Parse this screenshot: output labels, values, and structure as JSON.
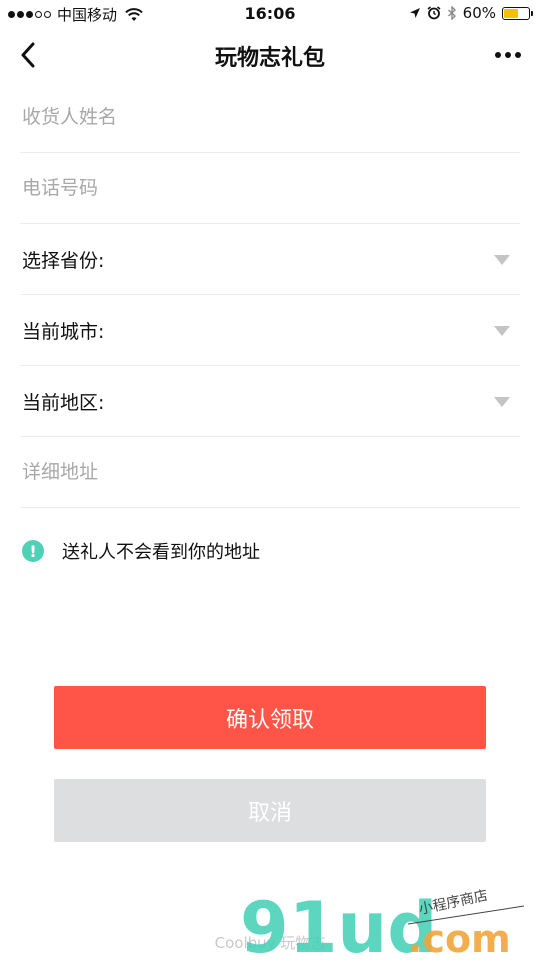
{
  "status_bar": {
    "carrier": "中国移动",
    "time": "16:06",
    "battery": "60%",
    "battery_level": 0.6,
    "icons": [
      "signal-dots-icon",
      "wifi-icon",
      "location-arrow-icon",
      "alarm-icon",
      "bluetooth-icon",
      "battery-icon"
    ]
  },
  "nav": {
    "title": "玩物志礼包",
    "back_icon": "chevron-left-icon",
    "more_icon": "more-dots-icon"
  },
  "form": {
    "name_placeholder": "收货人姓名",
    "phone_placeholder": "电话号码",
    "province_label": "选择省份:",
    "city_label": "当前城市:",
    "district_label": "当前地区:",
    "address_placeholder": "详细地址"
  },
  "notice": {
    "icon": "!",
    "text": "送礼人不会看到你的地址",
    "color": "#4fd1b5"
  },
  "buttons": {
    "confirm": "确认领取",
    "cancel": "取消",
    "confirm_color": "#ff5548",
    "cancel_color": "#dddedf"
  },
  "footer": {
    "text": "Coolbuy 玩物志"
  },
  "watermark": {
    "brand": "91ud",
    "domain": ".com",
    "tagline": "小程序商店"
  }
}
